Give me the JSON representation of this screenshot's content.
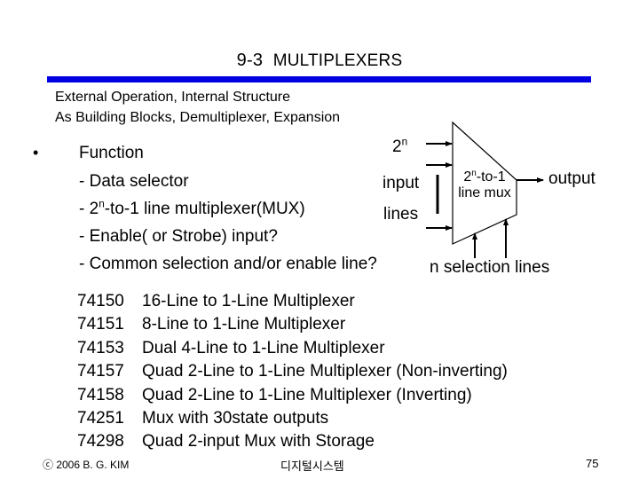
{
  "slide": {
    "title_prefix": "9-3",
    "title": "MULTIPLEXERS",
    "accent_color": "#0000e0",
    "subtitle_lines": [
      "External Operation, Internal Structure",
      "As Building Blocks, Demultiplexer, Expansion"
    ],
    "function": {
      "bullet": "•",
      "heading": "Function",
      "items": [
        {
          "pre": "- Data selector",
          "sup": "",
          "post": ""
        },
        {
          "pre": "- 2",
          "sup": "n",
          "post": "-to-1 line multiplexer(MUX)"
        },
        {
          "pre": "- Enable( or Strobe) input?",
          "sup": "",
          "post": ""
        },
        {
          "pre": "- Common selection and/or enable line?",
          "sup": "",
          "post": ""
        }
      ]
    },
    "diagram": {
      "inputs_base": "2",
      "inputs_sup": "n",
      "inputs_word1": "input",
      "inputs_word2": "lines",
      "mux_line1_base": "2",
      "mux_line1_sup": "n",
      "mux_line1_post": "-to-1",
      "mux_line2": "line mux",
      "output_label": "output",
      "select_label": "n selection lines"
    },
    "parts": [
      {
        "number": "74150",
        "description": "16-Line to 1-Line Multiplexer"
      },
      {
        "number": "74151",
        "description": "8-Line to 1-Line Multiplexer"
      },
      {
        "number": "74153",
        "description": "Dual 4-Line to 1-Line Multiplexer"
      },
      {
        "number": "74157",
        "description": "Quad 2-Line to 1-Line Multiplexer (Non-inverting)"
      },
      {
        "number": "74158",
        "description": "Quad 2-Line to 1-Line Multiplexer (Inverting)"
      },
      {
        "number": "74251",
        "description": "Mux with 30state outputs"
      },
      {
        "number": "74298",
        "description": "Quad 2-input Mux with Storage"
      }
    ],
    "footer": {
      "copyright": "ⓒ 2006 B. G. KIM",
      "course": "디지털시스템",
      "page_number": "75"
    }
  }
}
